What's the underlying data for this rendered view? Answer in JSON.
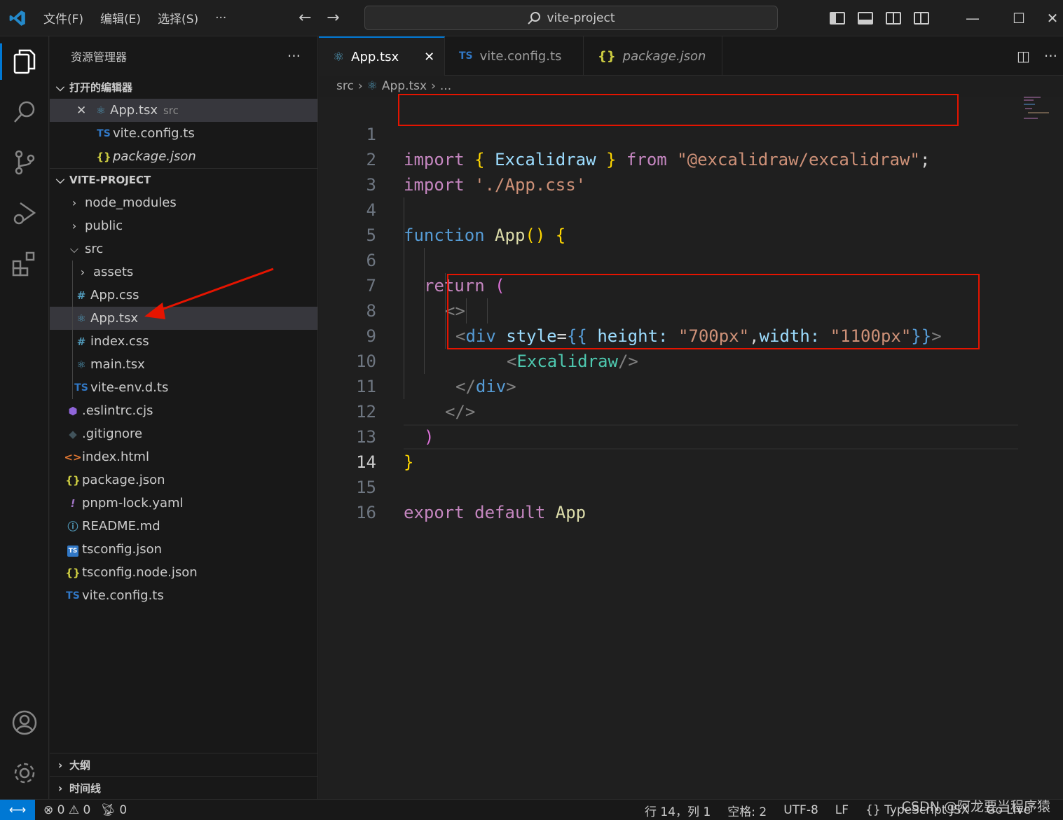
{
  "titlebar": {
    "menu": [
      "文件(F)",
      "编辑(E)",
      "选择(S)",
      "···"
    ],
    "search_label": "vite-project"
  },
  "sidebar": {
    "title": "资源管理器",
    "more": "···",
    "open_editors_title": "打开的编辑器",
    "open_editors": [
      {
        "name": "App.tsx",
        "hint": "src"
      },
      {
        "name": "vite.config.ts"
      },
      {
        "name": "package.json"
      }
    ],
    "project_title": "VITE-PROJECT",
    "tree": {
      "node_modules": "node_modules",
      "public": "public",
      "src": "src",
      "assets": "assets",
      "app_css": "App.css",
      "app_tsx": "App.tsx",
      "index_css": "index.css",
      "main_tsx": "main.tsx",
      "vite_env": "vite-env.d.ts",
      "eslintrc": ".eslintrc.cjs",
      "gitignore": ".gitignore",
      "index_html": "index.html",
      "package_json": "package.json",
      "pnpm_lock": "pnpm-lock.yaml",
      "readme": "README.md",
      "tsconfig": "tsconfig.json",
      "tsconfig_node": "tsconfig.node.json",
      "vite_config": "vite.config.ts"
    },
    "outline": "大纲",
    "timeline": "时间线"
  },
  "tabs": [
    {
      "label": "App.tsx",
      "close": "✕"
    },
    {
      "label": "vite.config.ts",
      "badge": "TS"
    },
    {
      "label": "package.json",
      "badge": "{}"
    }
  ],
  "breadcrumb": {
    "a": "src",
    "b": "App.tsx",
    "c": "..."
  },
  "editor": {
    "line_numbers": [
      "1",
      "2",
      "3",
      "4",
      "5",
      "6",
      "7",
      "8",
      "9",
      "10",
      "11",
      "12",
      "13",
      "14",
      "15",
      "16"
    ],
    "l1": {
      "import": "import",
      "open": "{",
      "name": "Excalidraw",
      "close": "}",
      "from": "from",
      "str": "\"@excalidraw/excalidraw\"",
      "semi": ";"
    },
    "l2": {
      "import": "import",
      "str": "'./App.css'"
    },
    "l4": {
      "kw": "function",
      "name": "App",
      "parens": "()",
      "brace": "{"
    },
    "l6": {
      "kw": "return",
      "paren": "("
    },
    "l7": {
      "frag": "<>"
    },
    "l8": {
      "lt": "<",
      "tag": "div",
      "attr": "style",
      "eq": "=",
      "open": "{{",
      "k1": "height:",
      "v1": "\"700px\"",
      "comma": ",",
      "k2": "width:",
      "v2": "\"1100px\"",
      "close": "}}",
      "gt": ">"
    },
    "l9": {
      "lt": "<",
      "tag": "Excalidraw",
      "end": "/>"
    },
    "l10": {
      "lt": "</",
      "tag": "div",
      "gt": ">"
    },
    "l11": {
      "frag": "</>"
    },
    "l12": {
      "paren": ")"
    },
    "l13": {
      "brace": "}"
    },
    "l15": {
      "export": "export",
      "default": "default",
      "name": "App"
    }
  },
  "status": {
    "errors": "0",
    "warnings": "0",
    "ports": "0",
    "position": "行 14，列 1",
    "spaces": "空格: 2",
    "encoding": "UTF-8",
    "eol": "LF",
    "language": "TypeScript JSX",
    "golive": "Go Live"
  },
  "watermark": "CSDN @阿龙要当程序猿"
}
